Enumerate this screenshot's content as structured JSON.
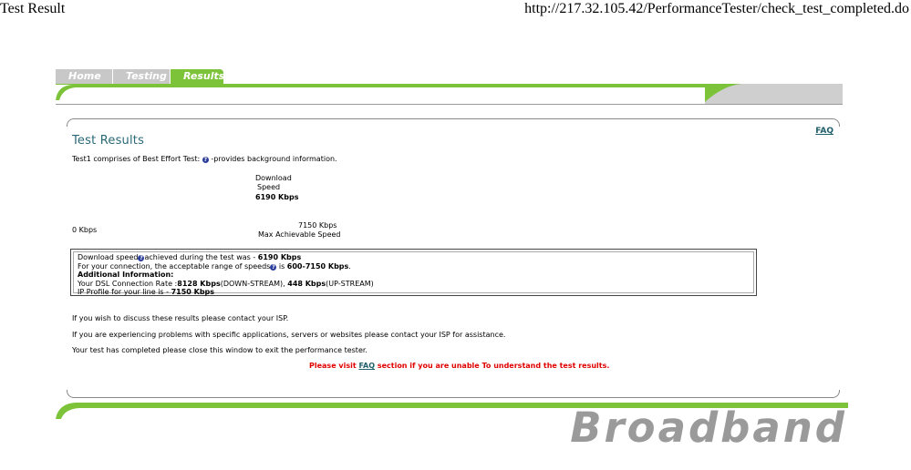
{
  "print_header": {
    "title": "Test Result",
    "url": "http://217.32.105.42/PerformanceTester/check_test_completed.do"
  },
  "tabs": [
    {
      "label": "Home",
      "active": false
    },
    {
      "label": "Testing",
      "active": false
    },
    {
      "label": "Results",
      "active": true
    }
  ],
  "faq_link": "FAQ",
  "heading": "Test Results",
  "intro": {
    "before_icon": "Test1 comprises of Best Effort Test:",
    "after_icon": "-provides background information."
  },
  "download": {
    "label_line1": "Download",
    "label_line2": "Speed",
    "value": "6190 Kbps"
  },
  "range": {
    "min": "0 Kbps",
    "max": "7150 Kbps",
    "max_label": "Max Achievable Speed"
  },
  "info": {
    "line1_pre": "Download speed",
    "line1_mid": "achieved during the test was - ",
    "line1_val": "6190 Kbps",
    "line2_pre": "For your connection, the acceptable range of speeds",
    "line2_mid": " is ",
    "line2_val": "600-7150 Kbps",
    "line2_end": ".",
    "line3": "Additional Information:",
    "line4_pre": "Your DSL Connection Rate :",
    "line4_down": "8128 Kbps",
    "line4_down_label": "(DOWN-STREAM), ",
    "line4_up": "448 Kbps",
    "line4_up_label": "(UP-STREAM)",
    "line5_pre": "IP Profile for your line is - ",
    "line5_val": "7150 Kbps"
  },
  "messages": {
    "p1": "If you wish to discuss these results please contact your ISP.",
    "p2": "If you are experiencing problems with specific applications, servers or websites please contact your ISP for assistance.",
    "p3": "Your test has completed please close this window to exit the performance tester.",
    "visit_pre": "Please visit ",
    "visit_link": "FAQ",
    "visit_post": " section if you are unable To understand the test results."
  },
  "footer": {
    "brand": "Broadband"
  },
  "colors": {
    "accent_green": "#7cc33a",
    "link_teal": "#1f5f6a",
    "warning_red": "#e00000"
  }
}
